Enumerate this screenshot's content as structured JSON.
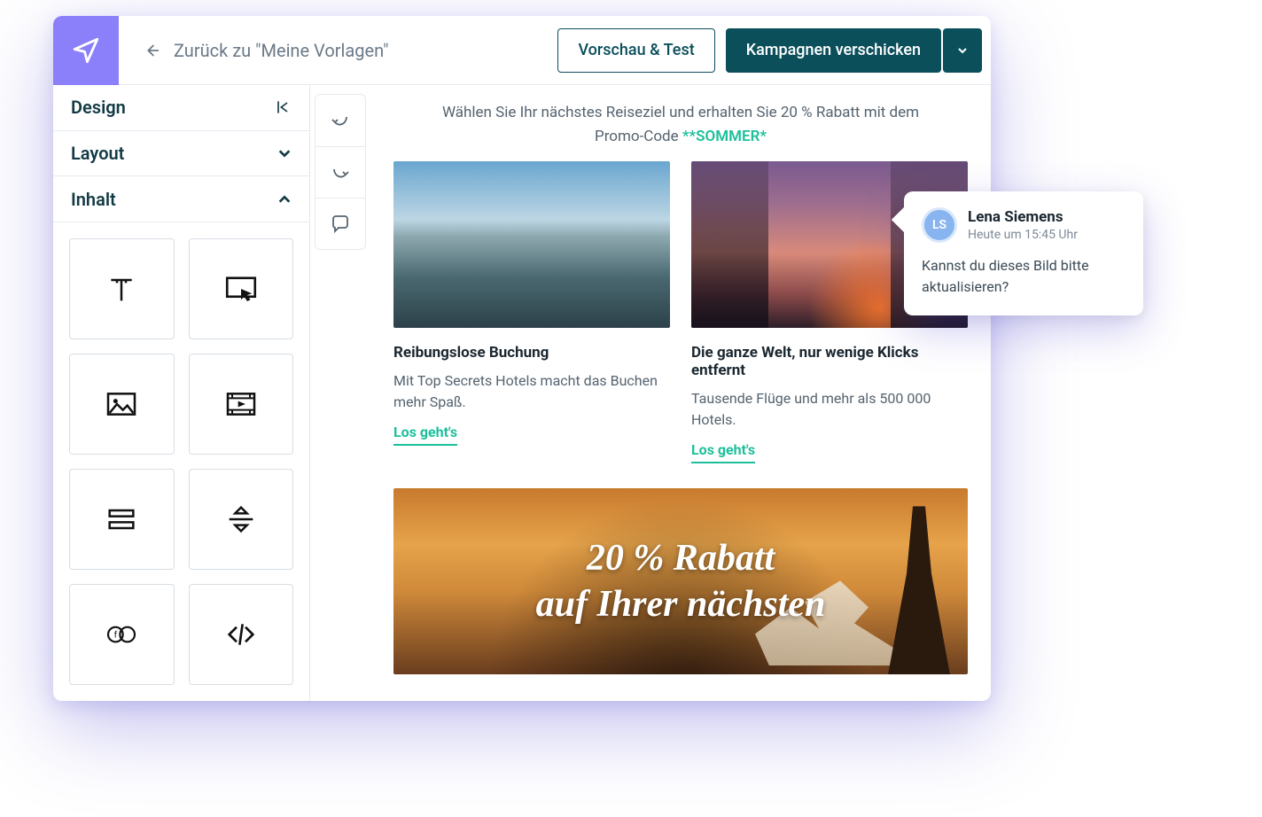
{
  "topbar": {
    "back_label": "Zurück zu \"Meine Vorlagen\"",
    "preview_label": "Vorschau & Test",
    "send_label": "Kampagnen verschicken"
  },
  "sidebar": {
    "design_label": "Design",
    "layout_label": "Layout",
    "content_label": "Inhalt",
    "blocks": [
      {
        "name": "text-block"
      },
      {
        "name": "button-block"
      },
      {
        "name": "image-block"
      },
      {
        "name": "video-block"
      },
      {
        "name": "columns-block"
      },
      {
        "name": "divider-block"
      },
      {
        "name": "social-block"
      },
      {
        "name": "html-block"
      }
    ]
  },
  "canvas": {
    "promo_lead": "Wählen Sie Ihr nächstes Reiseziel und erhalten Sie 20  % Rabatt mit dem",
    "promo_prefix": "Promo-Code ",
    "promo_code": "**SOMMER*",
    "cards": [
      {
        "title": "Reibungslose Buchung",
        "body": "Mit Top Secrets Hotels macht das Buchen mehr Spaß.",
        "cta": "Los geht's"
      },
      {
        "title": "Die ganze Welt, nur wenige Klicks entfernt",
        "body": "Tausende Flüge und mehr als 500 000 Hotels.",
        "cta": "Los geht's"
      }
    ],
    "hero_line1": "20 % Rabatt",
    "hero_line2": "auf Ihrer nächsten"
  },
  "comment": {
    "initials": "LS",
    "author": "Lena Siemens",
    "time": "Heute um 15:45 Uhr",
    "body": "Kannst du dieses Bild bitte aktualisieren?"
  }
}
